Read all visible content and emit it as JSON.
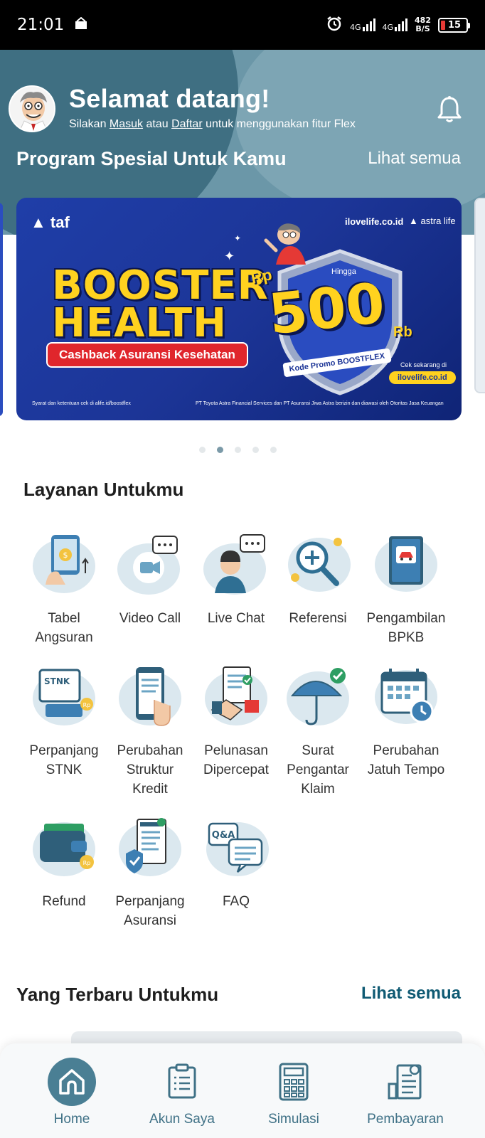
{
  "status_bar": {
    "time": "21:01",
    "network_1": "4G",
    "network_2": "4G",
    "speed_value": "482",
    "speed_unit": "B/S",
    "battery": "15",
    "icons": [
      "alarm-icon",
      "signal-icon",
      "battery-icon"
    ]
  },
  "header": {
    "welcome": "Selamat datang!",
    "sub_prefix": "Silakan ",
    "sub_login": "Masuk",
    "sub_mid": " atau ",
    "sub_register": "Daftar",
    "sub_suffix": " untuk menggunakan fitur Flex",
    "promo_title": "Program Spesial Untuk Kamu",
    "see_all": "Lihat semua"
  },
  "banner": {
    "taf": "taf",
    "ilovelife": "ilovelife.co.id",
    "astra": "astra life",
    "line1": "BOOSTER",
    "line2": "HEALTH",
    "cashback": "Cashback Asuransi Kesehatan",
    "rp": "Rp",
    "hingga": "Hingga",
    "amount": "500",
    "unit": "Rb",
    "promo_code": "Kode Promo BOOSTFLEX",
    "cek": "Cek sekarang di",
    "url_pill": "ilovelife.co.id",
    "terms": "Syarat dan ketentuan cek di alife.id/boostflex",
    "pt": "PT Toyota Astra Financial Services dan PT Asuransi Jiwa Astra berizin dan diawasi oleh Otoritas Jasa Keuangan"
  },
  "carousel": {
    "count": 5,
    "active": 2
  },
  "services": {
    "title": "Layanan Untukmu",
    "items": [
      {
        "line1": "Tabel",
        "line2": "Angsuran",
        "line3": ""
      },
      {
        "line1": "Video Call",
        "line2": "",
        "line3": ""
      },
      {
        "line1": "Live Chat",
        "line2": "",
        "line3": ""
      },
      {
        "line1": "Referensi",
        "line2": "",
        "line3": ""
      },
      {
        "line1": "Pengambilan",
        "line2": "BPKB",
        "line3": ""
      },
      {
        "line1": "Perpanjang",
        "line2": "STNK",
        "line3": ""
      },
      {
        "line1": "Perubahan",
        "line2": "Struktur",
        "line3": "Kredit"
      },
      {
        "line1": "Pelunasan",
        "line2": "Dipercepat",
        "line3": ""
      },
      {
        "line1": "Surat",
        "line2": "Pengantar",
        "line3": "Klaim"
      },
      {
        "line1": "Perubahan",
        "line2": "Jatuh Tempo",
        "line3": ""
      },
      {
        "line1": "Refund",
        "line2": "",
        "line3": ""
      },
      {
        "line1": "Perpanjang",
        "line2": "Asuransi",
        "line3": ""
      },
      {
        "line1": "FAQ",
        "line2": "",
        "line3": ""
      }
    ]
  },
  "latest": {
    "title": "Yang Terbaru Untukmu",
    "see_all": "Lihat semua"
  },
  "bottom_nav": [
    {
      "label": "Home",
      "icon": "home-icon"
    },
    {
      "label": "Akun Saya",
      "icon": "clipboard-icon"
    },
    {
      "label": "Simulasi",
      "icon": "calculator-icon"
    },
    {
      "label": "Pembayaran",
      "icon": "receipt-icon"
    }
  ],
  "colors": {
    "primary": "#4a7f94",
    "header_bg": "#6b97a8",
    "banner_bg": "#1c3597",
    "accent_yellow": "#ffd21f",
    "accent_red": "#e0262c",
    "link": "#0f5a73"
  }
}
